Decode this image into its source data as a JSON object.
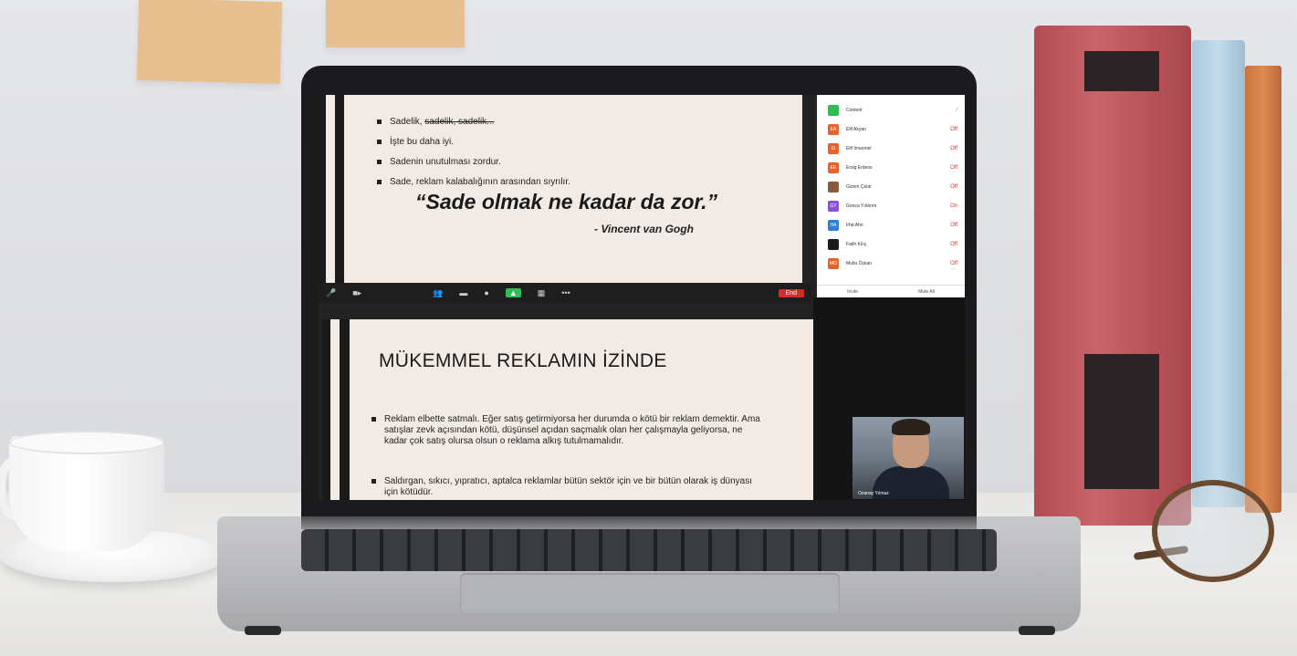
{
  "slide1": {
    "bullets": [
      {
        "text": "Sadelik,",
        "strike": "sadelik, sadelik..."
      },
      {
        "text": "İşte bu daha iyi."
      },
      {
        "text": "Sadenin unutulması zordur."
      },
      {
        "text": "Sade, reklam kalabalığının arasından sıyrılır."
      }
    ],
    "quote": "“Sade olmak ne kadar da zor.”",
    "author": "- Vincent van Gogh"
  },
  "toolbar": {
    "end": "End"
  },
  "participants": [
    {
      "initials": "",
      "name": "Content",
      "status": "",
      "color": "#2fbd55"
    },
    {
      "initials": "EA",
      "name": "Elif Akyan",
      "status": "Off",
      "color": "#e8632a"
    },
    {
      "initials": "EI",
      "name": "Elif İmanmel",
      "status": "Off",
      "color": "#e8632a"
    },
    {
      "initials": "EE",
      "name": "Ersig Erdens",
      "status": "Off",
      "color": "#e8632a"
    },
    {
      "initials": "",
      "name": "Gizem Çelar",
      "status": "Off",
      "color": "#8a5a3c"
    },
    {
      "initials": "GY",
      "name": "Gonca Yıldırım",
      "status": "On",
      "color": "#8a4fd8"
    },
    {
      "initials": "HA",
      "name": "Irfat Ahn",
      "status": "Off",
      "color": "#2b7fd6"
    },
    {
      "initials": "",
      "name": "Fatih Kılıç",
      "status": "Off",
      "color": "#1a1a1a"
    },
    {
      "initials": "MO",
      "name": "Mutlu Özkan",
      "status": "Off",
      "color": "#e8632a"
    }
  ],
  "participants_footer": {
    "invite": "Invite",
    "mute": "Mute All"
  },
  "slide2": {
    "title": "MÜKEMMEL REKLAMIN İZİNDE",
    "bullets": [
      "Reklam elbette satmalı. Eğer satış getirmiyorsa her durumda o kötü bir reklam demektir. Ama satışlar zevk açısından kötü, düşünsel açıdan saçmalık olan her çalışmayla geliyorsa, ne kadar çok satış olursa olsun o reklama alkış tutulmamalıdır.",
      "Saldırgan, sıkıcı, yıpratıcı, aptalca reklamlar bütün sektör için ve bir bütün olarak iş dünyası için kötüdür."
    ]
  },
  "video": {
    "name": "Ozanay Yılmaz"
  }
}
